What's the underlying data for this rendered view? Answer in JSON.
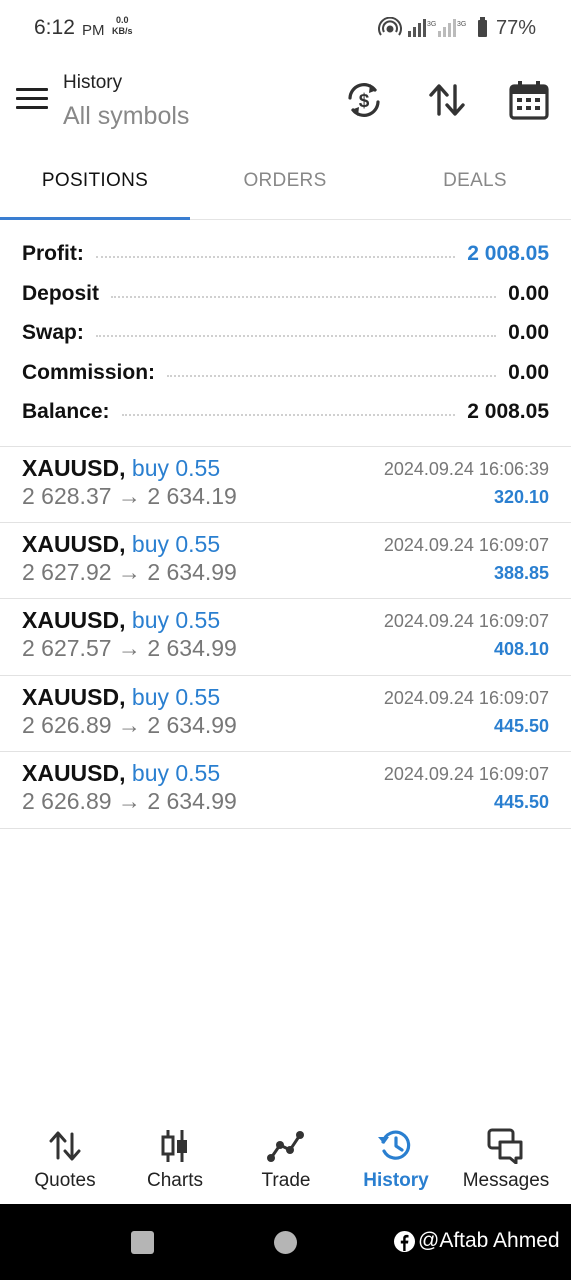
{
  "status_bar": {
    "time": "6:12",
    "ampm": "PM",
    "speed_value": "0.0",
    "speed_unit": "KB/s",
    "network_labels": [
      "3G",
      "3G"
    ],
    "battery": "77%"
  },
  "header": {
    "title": "History",
    "subtitle": "All symbols",
    "icons": [
      "menu-icon",
      "currency-sync-icon",
      "sort-icon",
      "calendar-icon"
    ]
  },
  "tabs": [
    {
      "label": "POSITIONS",
      "active": true
    },
    {
      "label": "ORDERS",
      "active": false
    },
    {
      "label": "DEALS",
      "active": false
    }
  ],
  "summary": {
    "profit": {
      "label": "Profit:",
      "value": "2 008.05"
    },
    "deposit": {
      "label": "Deposit",
      "value": "0.00"
    },
    "swap": {
      "label": "Swap:",
      "value": "0.00"
    },
    "commission": {
      "label": "Commission:",
      "value": "0.00"
    },
    "balance": {
      "label": "Balance:",
      "value": "2 008.05"
    }
  },
  "deals": [
    {
      "symbol": "XAUUSD,",
      "side": "buy 0.55",
      "open_price": "2 628.37",
      "arrow": "→",
      "close_price": "2 634.19",
      "time": "2024.09.24 16:06:39",
      "profit": "320.10"
    },
    {
      "symbol": "XAUUSD,",
      "side": "buy 0.55",
      "open_price": "2 627.92",
      "arrow": "→",
      "close_price": "2 634.99",
      "time": "2024.09.24 16:09:07",
      "profit": "388.85"
    },
    {
      "symbol": "XAUUSD,",
      "side": "buy 0.55",
      "open_price": "2 627.57",
      "arrow": "→",
      "close_price": "2 634.99",
      "time": "2024.09.24 16:09:07",
      "profit": "408.10"
    },
    {
      "symbol": "XAUUSD,",
      "side": "buy 0.55",
      "open_price": "2 626.89",
      "arrow": "→",
      "close_price": "2 634.99",
      "time": "2024.09.24 16:09:07",
      "profit": "445.50"
    },
    {
      "symbol": "XAUUSD,",
      "side": "buy 0.55",
      "open_price": "2 626.89",
      "arrow": "→",
      "close_price": "2 634.99",
      "time": "2024.09.24 16:09:07",
      "profit": "445.50"
    }
  ],
  "bottom_nav": [
    {
      "label": "Quotes",
      "icon": "quotes-icon",
      "active": false
    },
    {
      "label": "Charts",
      "icon": "charts-icon",
      "active": false
    },
    {
      "label": "Trade",
      "icon": "trade-icon",
      "active": false
    },
    {
      "label": "History",
      "icon": "history-icon",
      "active": true
    },
    {
      "label": "Messages",
      "icon": "messages-icon",
      "active": false
    }
  ],
  "watermark": "@Aftab Ahmed",
  "colors": {
    "accent": "#2a7fd0",
    "indicator": "#3a7ed1",
    "muted": "#777777"
  }
}
